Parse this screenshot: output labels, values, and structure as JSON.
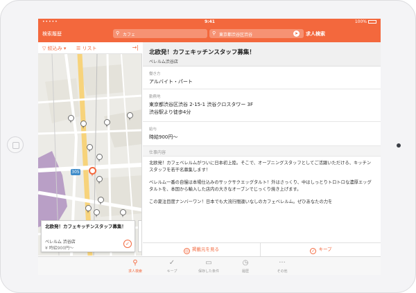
{
  "status": {
    "carrier": "•••••",
    "time": "9:41",
    "battery": "100%"
  },
  "header": {
    "history_label": "検索履歴",
    "keyword_value": "カフェ",
    "location_value": "東京都渋谷区渋谷",
    "search_button": "求人検索"
  },
  "map_bar": {
    "filter_label": "絞込み",
    "list_label": "リスト",
    "collapse_icon": "→|"
  },
  "map": {
    "route_number": "305",
    "card": {
      "title": "北欧発！カフェキッチンスタッフ募集！",
      "store": "ベレルム 渋谷店",
      "wage": "¥ 時給900円〜"
    }
  },
  "detail": {
    "title": "北欧発！カフェキッチンスタッフ募集！",
    "store": "ベレルム渋谷店",
    "sections": [
      {
        "label": "働き方",
        "value": "アルバイト・パート"
      },
      {
        "label": "勤務地",
        "value": "東京都渋谷区渋谷 2-15-1 渋谷クロスタワー 3F",
        "value2": "渋谷駅より徒歩4分"
      },
      {
        "label": "給与",
        "value": "時給900円〜"
      }
    ],
    "description_label": "仕事内容",
    "paragraphs": [
      "北欧発！カフェベレルムがついに日本初上陸。そこで、オープニングスタッフとしてご活躍いただける、キッチンスタッフを若干名募集します！",
      "ベレルム一番の自慢は本場仕込みのサックサクエッグタルト！外はさっくり、中はしっとりトロトロな濃厚エッグタルトを、本国から輸入した店内の大きなオーブンでじっくり焼き上げます。",
      "この夏注目度ナンバーワン！日本でも大流行間違いなしのカフェベレルム。ぜひあなたの力を"
    ]
  },
  "actions": {
    "source_label": "掲載元を見る",
    "keep_label": "キープ"
  },
  "tabs": [
    {
      "label": "求人検索",
      "icon": "search-icon"
    },
    {
      "label": "キープ",
      "icon": "check-icon"
    },
    {
      "label": "保存した条件",
      "icon": "folder-icon"
    },
    {
      "label": "履歴",
      "icon": "history-icon"
    },
    {
      "label": "その他",
      "icon": "more-icon"
    }
  ],
  "colors": {
    "accent": "#f3683d",
    "header": "#f3683d"
  }
}
